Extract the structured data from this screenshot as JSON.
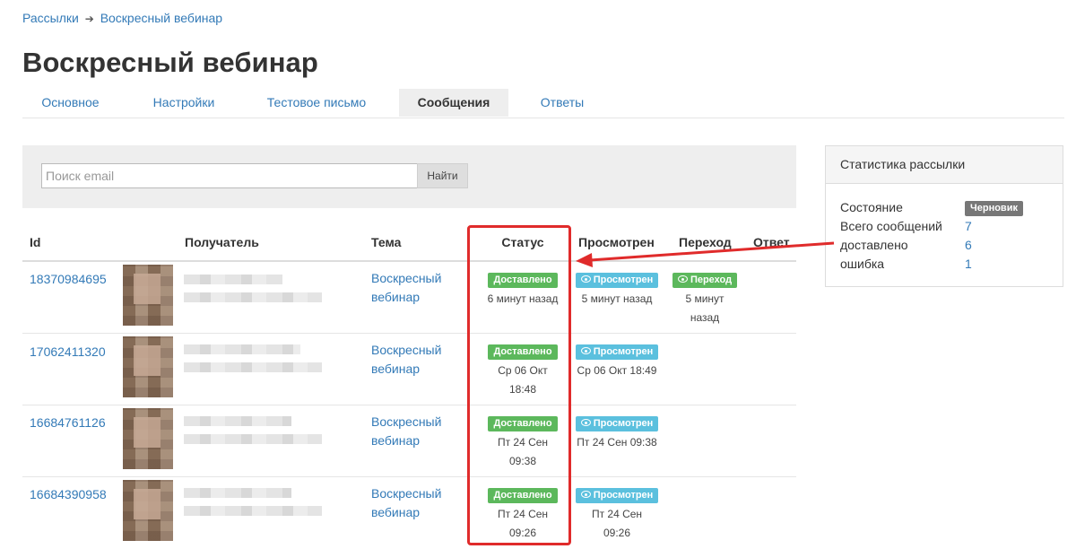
{
  "breadcrumb": {
    "parent": "Рассылки",
    "separator": "➔",
    "current": "Воскресный вебинар"
  },
  "page_title": "Воскресный вебинар",
  "tabs": [
    {
      "label": "Основное",
      "active": false
    },
    {
      "label": "Настройки",
      "active": false
    },
    {
      "label": "Тестовое письмо",
      "active": false
    },
    {
      "label": "Сообщения",
      "active": true
    },
    {
      "label": "Ответы",
      "active": false
    }
  ],
  "search": {
    "placeholder": "Поиск email",
    "button_label": "Найти"
  },
  "table": {
    "headers": {
      "id": "Id",
      "recipient": "Получатель",
      "subject": "Тема",
      "status": "Статус",
      "viewed": "Просмотрен",
      "click": "Переход",
      "reply": "Ответ"
    },
    "rows": [
      {
        "id": "18370984695",
        "subject": "Воскресный вебинар",
        "status_badge": "Доставлено",
        "status_time": "6 минут назад",
        "viewed_badge": "Просмотрен",
        "viewed_time": "5 минут назад",
        "click_badge": "Переход",
        "click_time": "5 минут назад"
      },
      {
        "id": "17062411320",
        "subject": "Воскресный вебинар",
        "status_badge": "Доставлено",
        "status_time": "Ср 06 Окт 18:48",
        "viewed_badge": "Просмотрен",
        "viewed_time": "Ср 06 Окт 18:49"
      },
      {
        "id": "16684761126",
        "subject": "Воскресный вебинар",
        "status_badge": "Доставлено",
        "status_time": "Пт 24 Сен 09:38",
        "viewed_badge": "Просмотрен",
        "viewed_time": "Пт 24 Сен 09:38"
      },
      {
        "id": "16684390958",
        "subject": "Воскресный вебинар",
        "status_badge": "Доставлено",
        "status_time": "Пт 24 Сен 09:26",
        "viewed_badge": "Просмотрен",
        "viewed_time": "Пт 24 Сен 09:26"
      }
    ]
  },
  "stats": {
    "title": "Статистика рассылки",
    "state_label": "Состояние",
    "state_badge": "Черновик",
    "total_label": "Всего сообщений",
    "total_value": "7",
    "delivered_label": "доставлено",
    "delivered_value": "6",
    "error_label": "ошибка",
    "error_value": "1"
  },
  "colors": {
    "link": "#337ab7",
    "badge_delivered": "#5cb85c",
    "badge_viewed": "#5bc0de",
    "badge_draft": "#777777",
    "annotation": "#e02b2b"
  }
}
